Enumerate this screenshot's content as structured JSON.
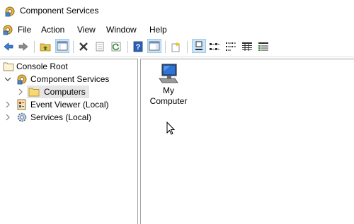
{
  "window": {
    "title": "Component Services",
    "app_icon": "component-services-icon"
  },
  "menu": {
    "items": [
      "File",
      "Action",
      "View",
      "Window",
      "Help"
    ]
  },
  "toolbar": {
    "buttons": [
      "back",
      "forward",
      "up-one-level",
      "show-hide-console-tree",
      "delete",
      "properties",
      "refresh",
      "help",
      "show-hide-action-pane",
      "new",
      "large-icons",
      "small-icons",
      "list",
      "detail",
      "status-view"
    ],
    "active": [
      "show-hide-console-tree",
      "large-icons"
    ]
  },
  "tree": {
    "root": "Console Root",
    "nodes": [
      {
        "label": "Component Services",
        "state": "expanded"
      },
      {
        "label": "Computers",
        "state": "collapsed",
        "selected": true
      },
      {
        "label": "Event Viewer (Local)",
        "state": "collapsed"
      },
      {
        "label": "Services (Local)",
        "state": "collapsed"
      }
    ]
  },
  "content": {
    "items": [
      {
        "line1": "My",
        "line2": "Computer",
        "icon": "computer-icon"
      }
    ]
  },
  "colors": {
    "selection": "#cce4f7",
    "tree_selected": "#e5e5e5",
    "folder": "#f8d775"
  }
}
